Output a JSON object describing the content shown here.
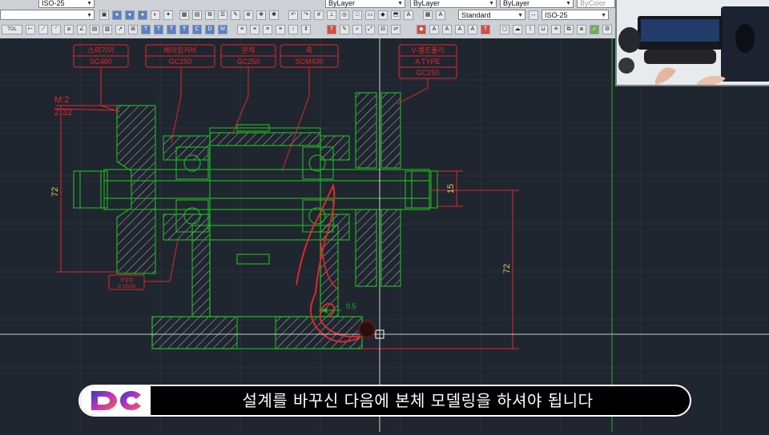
{
  "toolbar": {
    "layer_combo": "ISO-25",
    "linetype_combo_1": "ByLayer",
    "linetype_combo_2": "ByLayer",
    "lineweight_combo": "ByLayer",
    "plotstyle_combo": "ByColor",
    "textstyle_combo": "Standard",
    "dimstyle_combo": "ISO-25",
    "left_label": "TOL"
  },
  "drawing": {
    "part_labels": [
      {
        "name": "스퍼기어",
        "material": "SC480"
      },
      {
        "name": "베어링커버",
        "material": "GC250"
      },
      {
        "name": "본체",
        "material": "GC250"
      },
      {
        "name": "축",
        "material": "SCM430"
      },
      {
        "name": "V-벨트풀리",
        "spec": "A TYPE",
        "material": "GC250"
      }
    ],
    "gear_note_module": "M:2",
    "gear_note_teeth": "Z:32",
    "dim_left_height": "72",
    "dim_right_height": "72",
    "dim_shaft_diameter": "15",
    "dim_small": "0.5",
    "small_tag_line1": "오일씰",
    "small_tag_line2": "G 15x26"
  },
  "colors": {
    "background": "#1f2630",
    "outline": "#21b021",
    "annotation": "#e0282a",
    "hatch": "#b8bcc0",
    "crosshair": "#ffffff"
  },
  "caption": {
    "text": "설계를 바꾸신 다음에 본체 모델링을 하셔야 됩니다",
    "logo_text": "DC"
  }
}
